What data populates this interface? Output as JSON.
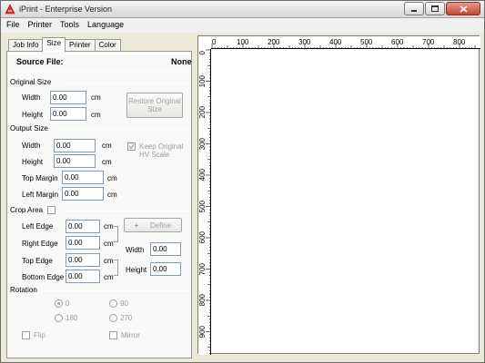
{
  "window": {
    "title": "iPrint - Enterprise Version",
    "accent_close": "#c44a37"
  },
  "menu": {
    "file": "File",
    "printer": "Printer",
    "tools": "Tools",
    "language": "Language"
  },
  "tabs": {
    "job_info": "Job Info",
    "size": "Size",
    "printer": "Printer",
    "color": "Color",
    "active": "Size"
  },
  "source": {
    "label": "Source File:",
    "value": "None"
  },
  "original_size": {
    "heading": "Original Size",
    "width_label": "Width",
    "width_value": "0.00",
    "height_label": "Height",
    "height_value": "0.00",
    "unit": "cm",
    "restore_button": "Restore Original Size"
  },
  "output_size": {
    "heading": "Output Size",
    "width_label": "Width",
    "width_value": "0.00",
    "height_label": "Height",
    "height_value": "0.00",
    "top_margin_label": "Top Margin",
    "top_margin_value": "0.00",
    "left_margin_label": "Left Margin",
    "left_margin_value": "0.00",
    "unit": "cm",
    "keep_scale_label": "Keep Original HV Scale",
    "keep_scale_checked": true
  },
  "crop_area": {
    "heading": "Crop Area",
    "enabled": false,
    "left_label": "Left   Edge",
    "left_value": "0.00",
    "right_label": "Right Edge",
    "right_value": "0.00",
    "top_label": "Top   Edge",
    "top_value": "0.00",
    "bottom_label": "Bottom Edge",
    "bottom_value": "0.00",
    "unit": "cm",
    "define_button": "Define",
    "width_label": "Width",
    "width_value": "0.00",
    "height_label": "Height",
    "height_value": "0.00"
  },
  "rotation": {
    "heading": "Rotation",
    "options": [
      "0",
      "90",
      "180",
      "270"
    ],
    "selected": "0",
    "flip_label": "Flip",
    "mirror_label": "Mirror"
  },
  "ruler": {
    "horizontal": [
      "0",
      "100",
      "200",
      "300",
      "400",
      "500",
      "600",
      "700",
      "800"
    ],
    "vertical": [
      "0",
      "100",
      "200",
      "300",
      "400",
      "500",
      "600",
      "700",
      "800",
      "900"
    ]
  }
}
